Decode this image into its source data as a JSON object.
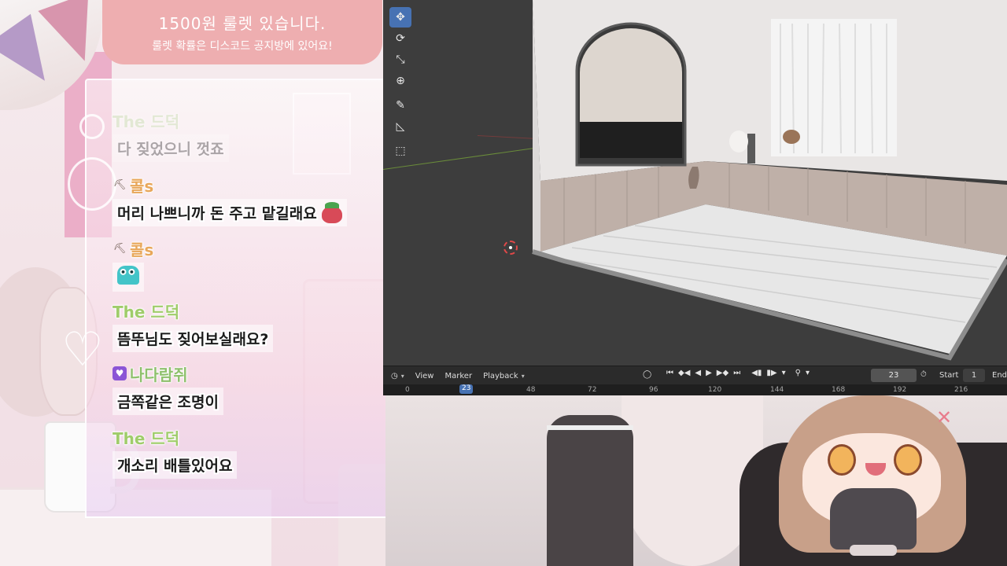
{
  "banner": {
    "title": "1500원 룰렛 있습니다.",
    "subtitle": "룰렛 확률은 디스코드 공지방에 있어요!"
  },
  "chat": {
    "messages": [
      {
        "user": "The 드덕",
        "text": "다 짖었으니 껏죠",
        "badge": "",
        "faded": true,
        "name_color": "#b8d69a"
      },
      {
        "user": "콜s",
        "text": "머리 나쁘니까 돈 주고 맡길래요",
        "badge": "shovel-icon",
        "faded": false,
        "name_color": "#e8a75a",
        "emoji": "red-blob-emoji"
      },
      {
        "user": "콜s",
        "text": "",
        "badge": "shovel-icon",
        "faded": false,
        "name_color": "#e8a75a",
        "emoji": "teal-ghost-emoji"
      },
      {
        "user": "The 드덕",
        "text": "뜸뚜님도 짖어보실래요?",
        "badge": "",
        "faded": false,
        "name_color": "#9fcc6a"
      },
      {
        "user": "나다람쥐",
        "text": "금쪽같은 조명이",
        "badge": "heart-icon",
        "faded": false,
        "name_color": "#8ec06c"
      },
      {
        "user": "The 드덕",
        "text": "개소리 배틀있어요",
        "badge": "",
        "faded": false,
        "name_color": "#9fcc6a"
      }
    ]
  },
  "blender": {
    "tools": [
      {
        "name": "move-tool",
        "glyph": "✥",
        "active": true
      },
      {
        "name": "rotate-tool",
        "glyph": "⟳",
        "active": false
      },
      {
        "name": "scale-tool",
        "glyph": "⤡",
        "active": false
      },
      {
        "name": "transform-tool",
        "glyph": "⊕",
        "active": false
      },
      {
        "name": "annotate-tool",
        "glyph": "✎",
        "active": false
      },
      {
        "name": "measure-tool",
        "glyph": "📐",
        "active": false
      },
      {
        "name": "add-cube-tool",
        "glyph": "⬚",
        "active": false
      }
    ],
    "timeline": {
      "view_label": "View",
      "marker_label": "Marker",
      "playback_label": "Playback",
      "current_frame": "23",
      "start_label": "Start",
      "start_value": "1",
      "end_label": "End",
      "ticks": [
        "0",
        "48",
        "72",
        "96",
        "120",
        "144",
        "168",
        "192",
        "216"
      ],
      "frame_marker": "23"
    },
    "colors": {
      "accent": "#4772b3",
      "viewport": "#3d3d3d",
      "header": "#2b2b2b"
    }
  }
}
